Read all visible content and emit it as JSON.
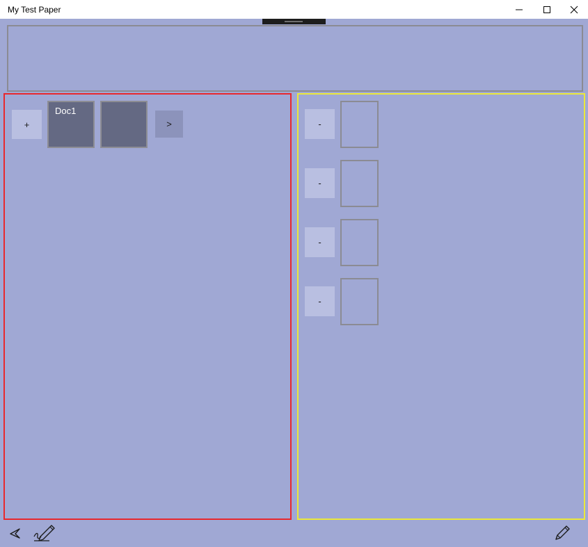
{
  "window": {
    "title": "My Test Paper",
    "minimize_icon": "minimize-icon",
    "maximize_icon": "maximize-icon",
    "close_icon": "close-icon"
  },
  "left_panel": {
    "add_button_label": "+",
    "documents": [
      {
        "label": "Doc1"
      },
      {
        "label": ""
      }
    ],
    "next_button_label": ">"
  },
  "right_panel": {
    "rows": [
      {
        "remove_label": "-"
      },
      {
        "remove_label": "-"
      },
      {
        "remove_label": "-"
      },
      {
        "remove_label": "-"
      }
    ]
  },
  "bottom_bar": {
    "left_icons": [
      "navigate-arrow-icon",
      "signature-pen-icon"
    ],
    "right_icons": [
      "pencil-icon"
    ]
  },
  "colors": {
    "background": "#a0a8d4",
    "top_panel_border": "#8b8b93",
    "left_panel_border": "#e8282d",
    "right_panel_border": "#ebe83a",
    "doc_tile": "#646983",
    "button_light": "#b9bfe1",
    "button_dark": "#8c93bb"
  }
}
